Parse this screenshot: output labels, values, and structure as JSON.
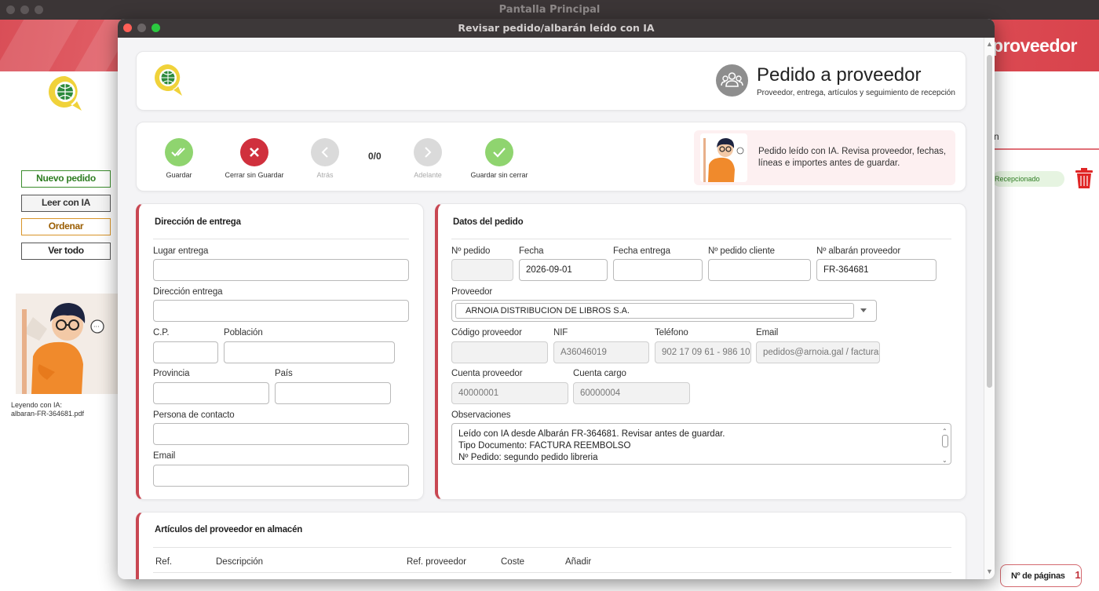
{
  "background_window": {
    "title": "Pantalla Principal",
    "banner_text": "proveedor",
    "sidebar_buttons": [
      {
        "label": "Nuevo pedido"
      },
      {
        "label": "Leer con IA"
      },
      {
        "label": "Ordenar"
      },
      {
        "label": "Ver todo"
      }
    ],
    "reading_status": [
      "Leyendo con IA:",
      "albaran-FR-364681.pdf"
    ],
    "right_header_fragment": "n",
    "status_badge": "Recepcionado",
    "pages_label": "Nº de páginas",
    "pages_value": "1"
  },
  "dialog": {
    "title": "Revisar pedido/albarán leído con IA",
    "header": {
      "title": "Pedido a proveedor",
      "subtitle": "Proveedor, entrega, artículos y seguimiento de recepción"
    },
    "toolbar": {
      "save": "Guardar",
      "close_no_save": "Cerrar sin Guardar",
      "back": "Atrás",
      "counter": "0/0",
      "forward": "Adelante",
      "save_no_close": "Guardar sin cerrar",
      "hint": "Pedido leído con IA. Revisa proveedor, fechas, líneas e importes antes de guardar."
    },
    "delivery": {
      "title": "Dirección de entrega",
      "lugar_label": "Lugar entrega",
      "lugar_value": "",
      "direccion_label": "Dirección entrega",
      "direccion_value": "",
      "cp_label": "C.P.",
      "cp_value": "",
      "poblacion_label": "Población",
      "poblacion_value": "",
      "provincia_label": "Provincia",
      "provincia_value": "",
      "pais_label": "País",
      "pais_value": "",
      "contacto_label": "Persona de contacto",
      "contacto_value": "",
      "email_label": "Email",
      "email_value": ""
    },
    "order": {
      "title": "Datos del pedido",
      "num_pedido_label": "Nº pedido",
      "num_pedido_value": "",
      "fecha_label": "Fecha",
      "fecha_value": "2026-09-01",
      "fecha_entrega_label": "Fecha entrega",
      "fecha_entrega_value": "",
      "pedido_cliente_label": "Nº pedido cliente",
      "pedido_cliente_value": "",
      "albaran_label": "Nº albarán proveedor",
      "albaran_value": "FR-364681",
      "proveedor_label": "Proveedor",
      "proveedor_value": "ARNOIA DISTRIBUCION DE LIBROS S.A.",
      "codigo_label": "Código proveedor",
      "codigo_value": "",
      "nif_label": "NIF",
      "nif_value": "A36046019",
      "telefono_label": "Teléfono",
      "telefono_value": "902 17 09 61 - 986 10",
      "email_label": "Email",
      "email_value": "pedidos@arnoia.gal / facturas",
      "cuenta_prov_label": "Cuenta proveedor",
      "cuenta_prov_value": "40000001",
      "cuenta_cargo_label": "Cuenta cargo",
      "cuenta_cargo_value": "60000004",
      "observaciones_label": "Observaciones",
      "observaciones_lines": [
        "Leído con IA desde Albarán FR-364681. Revisar antes de guardar.",
        "Tipo Documento: FACTURA REEMBOLSO",
        "Nº Pedido: segundo pedido libreria"
      ]
    },
    "articles": {
      "title": "Artículos del proveedor en almacén",
      "columns": [
        "Ref.",
        "Descripción",
        "Ref. proveedor",
        "Coste",
        "Añadir"
      ]
    }
  },
  "colors": {
    "accent_red": "#c84752",
    "save_green": "#8fd46f",
    "cancel_red": "#d0303d"
  }
}
